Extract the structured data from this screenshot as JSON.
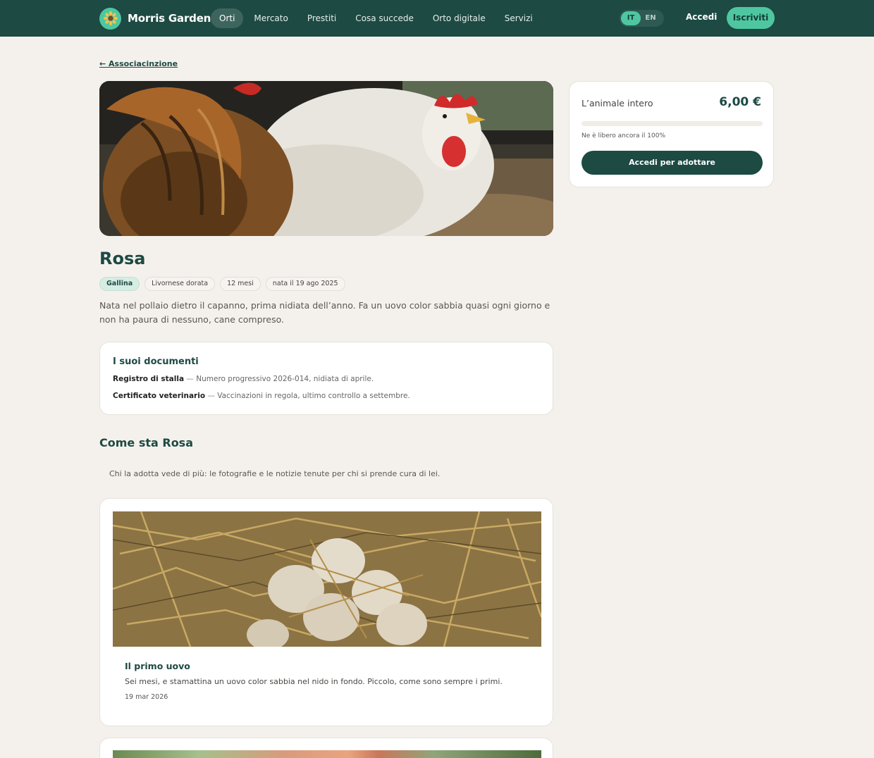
{
  "nav": {
    "brand": "Morris Garden",
    "brand_icon": "sunflower-icon",
    "links": [
      {
        "label": "Orti",
        "active": true
      },
      {
        "label": "Mercato",
        "active": false
      },
      {
        "label": "Prestiti",
        "active": false
      },
      {
        "label": "Cosa succede",
        "active": false
      },
      {
        "label": "Orto digitale",
        "active": false
      },
      {
        "label": "Servizi",
        "active": false
      }
    ],
    "languages": [
      "IT",
      "EN"
    ],
    "active_language": "IT",
    "login_label": "Accedi",
    "signup_label": "Iscriviti"
  },
  "back_link": "← Associacinzione",
  "animal": {
    "name": "Rosa",
    "tags": [
      "Gallina",
      "Livornese dorata",
      "12 mesi",
      "nata il 19 ago 2025"
    ],
    "description": "Nata nel pollaio dietro il capanno, prima nidiata dell’anno. Fa un uovo color sabbia quasi ogni giorno e non ha paura di nessuno, cane compreso."
  },
  "documents": {
    "title": "I suoi documenti",
    "items": [
      {
        "name": "Registro di stalla",
        "separator": " — ",
        "text": "Numero progressivo 2026-014, nidiata di aprile."
      },
      {
        "name": "Certificato veterinario",
        "separator": " — ",
        "text": "Vaccinazioni in regola, ultimo controllo a settembre."
      }
    ]
  },
  "updates": {
    "title": "Come sta Rosa",
    "subtitle": "Chi la adotta vede di più: le fotografie e le notizie tenute per chi si prende cura di lei.",
    "posts": [
      {
        "title": "Il primo uovo",
        "body": "Sei mesi, e stamattina un uovo color sabbia nel nido in fondo. Piccolo, come sono sempre i primi.",
        "date": "19 mar 2026"
      }
    ]
  },
  "adoption": {
    "label": "L’animale intero",
    "price": "6,00 €",
    "free_text": "Ne è libero ancora il 100%",
    "free_fraction": 0,
    "button": "Accedi per adottare"
  },
  "colors": {
    "primary": "#1d4a43",
    "accent": "#4ec7a0",
    "background": "#f4f1ed"
  }
}
